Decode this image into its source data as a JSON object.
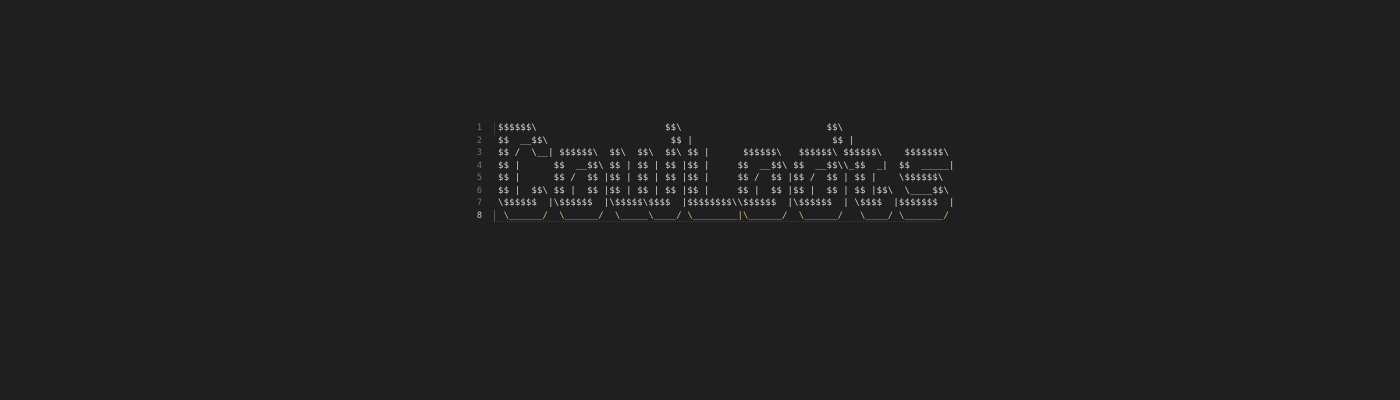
{
  "editor": {
    "lines": [
      {
        "number": "1",
        "text": "$$$$$$\\                       $$\\                          $$\\"
      },
      {
        "number": "2",
        "text": "$$  __$$\\                      $$ |                         $$ |"
      },
      {
        "number": "3",
        "text": "$$ /  \\__| $$$$$$\\  $$\\  $$\\  $$\\ $$ |      $$$$$$\\   $$$$$$\\ $$$$$$\\    $$$$$$$\\"
      },
      {
        "number": "4",
        "text": "$$ |      $$  __$$\\ $$ | $$ | $$ |$$ |     $$  __$$\\ $$  __$$\\\\_$$  _|  $$  _____|"
      },
      {
        "number": "5",
        "text": "$$ |      $$ /  $$ |$$ | $$ | $$ |$$ |     $$ /  $$ |$$ /  $$ | $$ |    \\$$$$$$\\"
      },
      {
        "number": "6",
        "text": "$$ |  $$\\ $$ |  $$ |$$ | $$ | $$ |$$ |     $$ |  $$ |$$ |  $$ | $$ |$$\\  \\____$$\\"
      },
      {
        "number": "7",
        "text": "\\$$$$$$  |\\$$$$$$  |\\$$$$$\\$$$$  |$$$$$$$$\\\\$$$$$$  |\\$$$$$$  | \\$$$$  |$$$$$$$  |"
      },
      {
        "number": "8",
        "text": " \\______/  \\______/  \\_____\\____/ \\________|\\______/  \\______/   \\____/ \\_______/"
      }
    ],
    "current_line": "8"
  }
}
